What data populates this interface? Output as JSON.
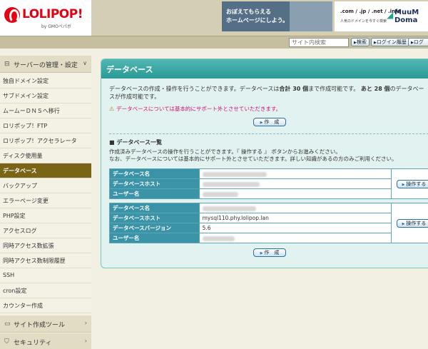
{
  "brand": {
    "name": "LOLIPOP!",
    "sub": "by GMOペパボ"
  },
  "banners": {
    "left": {
      "line1": "おぼえてもらえる",
      "line2": "ホームページにしよう。"
    },
    "right": {
      "domains": ".com / .jp / .net / .info",
      "tagline": "人気のドメインを今すぐ検索",
      "logo1": "MuuM",
      "logo2": "Doma"
    }
  },
  "toolbar": {
    "search_placeholder": "サイト内検索",
    "search_button": "検索",
    "login_history": "ログイン履歴",
    "logout": "ログ"
  },
  "sidebar": {
    "sections": [
      {
        "label": "サーバーの管理・設定",
        "icon": "lock-icon"
      },
      {
        "label": "サイト作成ツール",
        "icon": "monitor-icon"
      },
      {
        "label": "セキュリティ",
        "icon": "shield-icon"
      }
    ],
    "items": [
      "独自ドメイン設定",
      "サブドメイン設定",
      "ムームーＤＮＳへ移行",
      "ロリポップ！FTP",
      "ロリポップ！アクセラレータ",
      "ディスク使用量",
      "データベース",
      "バックアップ",
      "エラーページ変更",
      "PHP設定",
      "アクセスログ",
      "同時アクセス数拡張",
      "同時アクセス数制限履歴",
      "SSH",
      "cron設定",
      "カウンター作成"
    ],
    "active_index": 6
  },
  "main": {
    "title": "データベース",
    "desc_a": "データベースの作成・操作を行うことができます。データベースは",
    "desc_total": "合計 30 個",
    "desc_b": "まで作成可能です。",
    "desc_remain": "あと 28 個",
    "desc_c": "のデータベースが作成可能です。",
    "warning": "データベースについては基本的にサポート外とさせていただきます。",
    "create_button": "作　成",
    "list_title": "■ データベース一覧",
    "list_desc1": "作成済みデータベースの操作を行うことができます。『 操作する 』 ボタンからお進みください。",
    "list_desc2": "なお、データベースについては基本的にサポート外とさせていただきます。詳しい知識があるの方のみご利用ください。",
    "operate_button": "操作する",
    "db1": {
      "name_label": "データベース名",
      "host_label": "データベースホスト",
      "user_label": "ユーザー名"
    },
    "db2": {
      "name_label": "データベース名",
      "host_label": "データベースホスト",
      "host_value": "mysql110.phy.lolipop.lan",
      "version_label": "データベースバージョン",
      "version_value": "5.6",
      "user_label": "ユーザー名"
    }
  }
}
